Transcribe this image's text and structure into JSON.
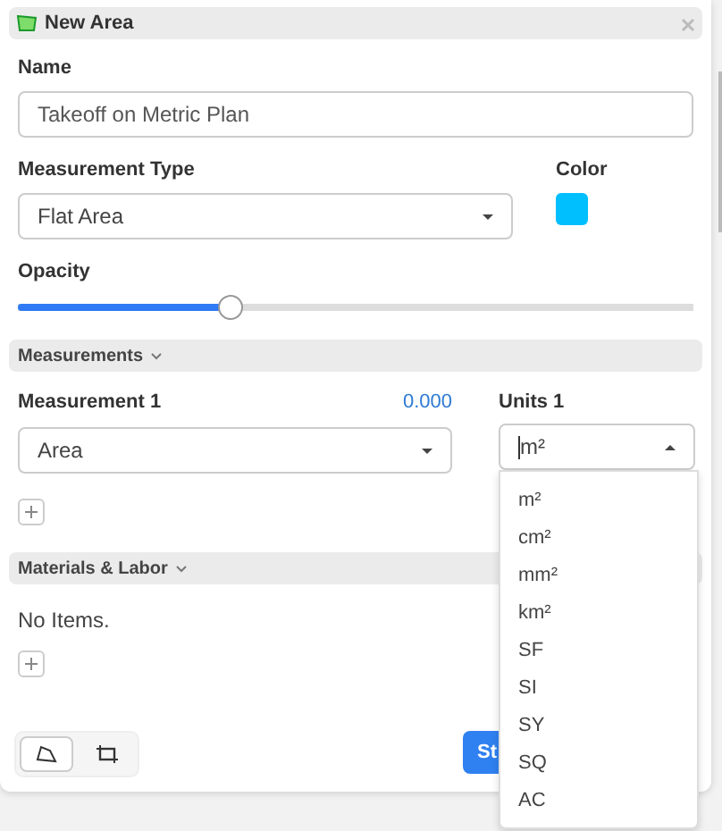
{
  "panel": {
    "title": "New Area"
  },
  "name": {
    "label": "Name",
    "value": "Takeoff on Metric Plan"
  },
  "measurement_type": {
    "label": "Measurement Type",
    "value": "Flat Area"
  },
  "color": {
    "label": "Color",
    "color": "#00bfff"
  },
  "opacity": {
    "label": "Opacity",
    "level": 0.315
  },
  "measurements": {
    "title": "Measurements",
    "expanded": true,
    "label": "Measurement 1",
    "reading": "0.000",
    "value": "Area",
    "units_label": "Units 1",
    "units": {
      "value": "m²",
      "expanded": true,
      "options": [
        "m²",
        "cm²",
        "mm²",
        "km²",
        "SF",
        "SI",
        "SY",
        "SQ",
        "AC"
      ]
    }
  },
  "materials": {
    "title": "Materials & Labor",
    "expanded": true,
    "empty_text": "No Items."
  },
  "tools": [
    {
      "kind": "polygon",
      "selected": true
    },
    {
      "kind": "rectangle",
      "selected": false
    }
  ],
  "start_button": "St"
}
